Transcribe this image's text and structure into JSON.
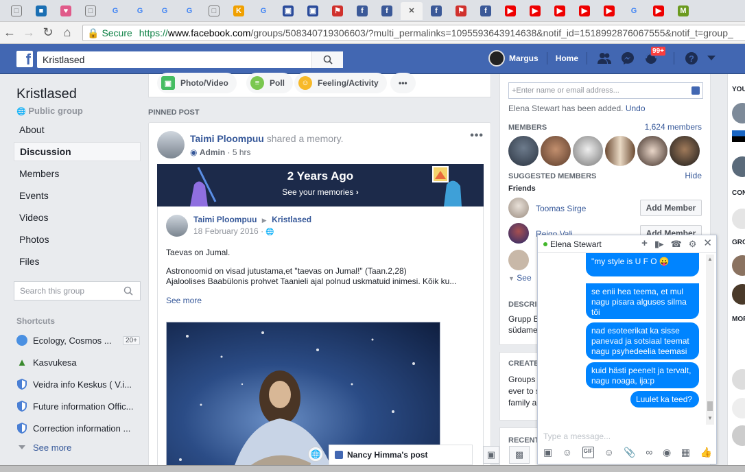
{
  "browser": {
    "tabs": [
      {
        "icon": "doc-icon",
        "color": "#777"
      },
      {
        "icon": "blue-square-icon",
        "color": "#1a6fb3"
      },
      {
        "icon": "heart-icon",
        "color": "#e05a8a"
      },
      {
        "icon": "doc-icon",
        "color": "#777"
      },
      {
        "icon": "google-icon",
        "color": "#4285f4"
      },
      {
        "icon": "google-icon",
        "color": "#4285f4"
      },
      {
        "icon": "google-icon",
        "color": "#4285f4"
      },
      {
        "icon": "google-icon",
        "color": "#4285f4"
      },
      {
        "icon": "doc-icon",
        "color": "#777"
      },
      {
        "icon": "k-icon",
        "color": "#f0a000"
      },
      {
        "icon": "google-icon",
        "color": "#4285f4"
      },
      {
        "icon": "bbs-icon",
        "color": "#2a4b9b"
      },
      {
        "icon": "bbs-icon",
        "color": "#2a4b9b"
      },
      {
        "icon": "red-flag-icon",
        "color": "#d0312d"
      },
      {
        "icon": "facebook-icon",
        "color": "#3b5998"
      },
      {
        "icon": "facebook-icon",
        "color": "#3b5998"
      },
      {
        "icon": "close-icon",
        "color": "#555",
        "active": true
      },
      {
        "icon": "facebook-icon",
        "color": "#3b5998"
      },
      {
        "icon": "red-flag-icon",
        "color": "#d0312d"
      },
      {
        "icon": "facebook-icon",
        "color": "#3b5998"
      },
      {
        "icon": "youtube-icon",
        "color": "#e00"
      },
      {
        "icon": "youtube-icon",
        "color": "#e00"
      },
      {
        "icon": "youtube-icon",
        "color": "#e00"
      },
      {
        "icon": "youtube-icon",
        "color": "#e00"
      },
      {
        "icon": "youtube-icon",
        "color": "#e00"
      },
      {
        "icon": "google-icon",
        "color": "#4285f4"
      },
      {
        "icon": "youtube-icon",
        "color": "#e00"
      },
      {
        "icon": "m-icon",
        "color": "#6b9a1f"
      }
    ],
    "secure_label": "Secure",
    "url_prefix": "https://",
    "url_host": "www.facebook.com",
    "url_rest": "/groups/508340719306603/?multi_permalinks=1095593643914638&notif_id=1518992876067555&notif_t=group_"
  },
  "fb": {
    "search_value": "Kristlased",
    "user_name": "Margus",
    "home_label": "Home",
    "notif_badge": "99+"
  },
  "left": {
    "group_title": "Kristlased",
    "group_type": "Public group",
    "nav": [
      "About",
      "Discussion",
      "Members",
      "Events",
      "Videos",
      "Photos",
      "Files"
    ],
    "selected_nav": "Discussion",
    "search_placeholder": "Search this group",
    "shortcuts_heading": "Shortcuts",
    "shortcuts": [
      {
        "label": "Ecology, Cosmos ...",
        "count": "20+",
        "icon": "group-icon"
      },
      {
        "label": "Kasvukesa",
        "icon": "tree-icon"
      },
      {
        "label": "Veidra info Keskus ( V.i...",
        "icon": "shield-icon"
      },
      {
        "label": "Future information Offic...",
        "icon": "shield-icon"
      },
      {
        "label": "Correction information ...",
        "icon": "shield-icon"
      }
    ],
    "see_more": "See more"
  },
  "composer": {
    "buttons": [
      "Photo/Video",
      "Poll",
      "Feeling/Activity"
    ]
  },
  "post": {
    "pinned_label": "PINNED POST",
    "author": "Taimi Ploompuu",
    "action": "shared a memory.",
    "role": "Admin",
    "time": "5 hrs",
    "memory_title": "2 Years Ago",
    "memory_sub": "See your memories",
    "shared_author": "Taimi Ploompuu",
    "shared_group": "Kristlased",
    "shared_date": "18 February 2016 ·",
    "line1": "Taevas on Jumal.",
    "line2": "Astronoomid on visad jutustama,et \"taevas on Jumal!\" (Taan.2,28)",
    "line3": "Ajaloolises Baabülonis prohvet Taanieli ajal polnud uskmatuid inimesi. Kõik ku...",
    "see_more": "See more"
  },
  "right": {
    "invite_placeholder": "+Enter name or email address...",
    "added_text": "Elena Stewart has been added.",
    "undo": "Undo",
    "members_label": "MEMBERS",
    "members_count": "1,624 members",
    "suggested_label": "SUGGESTED MEMBERS",
    "hide": "Hide",
    "friends_label": "Friends",
    "suggested": [
      {
        "name": "Toomas Sirge",
        "button": "Add Member"
      },
      {
        "name": "Reigo Vali",
        "button": "Add Member"
      }
    ],
    "see": "See",
    "descrip_label": "DESCRIP",
    "descrip_text1": "Grupp E",
    "descrip_text2": "südame",
    "create_label": "CREATE",
    "create_text1": "Groups",
    "create_text2": "ever to s",
    "create_text3": "family a",
    "recent_label": "RECENT"
  },
  "farright": {
    "labels": [
      "YOU",
      "CON",
      "GRO",
      "MOR"
    ]
  },
  "chat": {
    "name": "Elena Stewart",
    "messages": [
      "\"my style is U F O 😛",
      "se enii hea teema, et mul nagu pisara alguses silma tõi",
      "nad esoteerikat ka sisse panevad ja sotsiaal teemat nagu psyhedeelia teemasi",
      "kuid hästi peenelt ja tervalt, nagu noaga, ija:p",
      "Luulet ka teed?"
    ],
    "input_placeholder": "Type a message..."
  },
  "posttab": {
    "label": "Nancy Himma's post"
  }
}
